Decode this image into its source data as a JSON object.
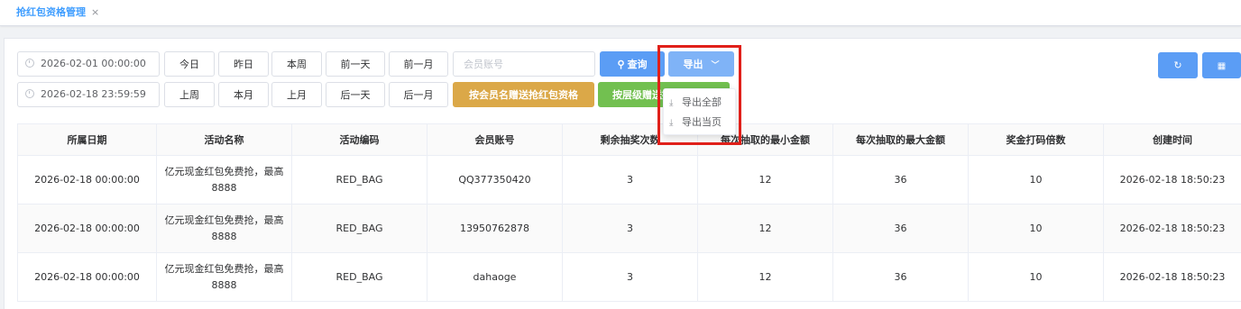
{
  "tab": {
    "label": "抢红包资格管理",
    "close": "×"
  },
  "filters": {
    "start_date": "2026-02-01 00:00:00",
    "end_date": "2026-02-18 23:59:59",
    "member_placeholder": "会员账号",
    "row1_buttons": [
      "今日",
      "昨日",
      "本周",
      "前一天",
      "前一月"
    ],
    "row2_buttons": [
      "上周",
      "本月",
      "上月",
      "后一天",
      "后一月"
    ],
    "query_label": "查询",
    "export_label": "导出",
    "gift_by_member_label": "按会员名赠送抢红包资格",
    "gift_by_level_label": "按层级赠送抢红包资格"
  },
  "export_menu": {
    "items": [
      {
        "label": "导出全部",
        "icon": "download-icon"
      },
      {
        "label": "导出当页",
        "icon": "download-icon"
      }
    ]
  },
  "toolbar": {
    "refresh_icon": "refresh-icon",
    "grid_icon": "grid-icon"
  },
  "colors": {
    "primary": "#5b9df5",
    "warning": "#dba848",
    "success": "#72c050",
    "highlight": "#e0201a"
  },
  "table": {
    "headers": [
      "所属日期",
      "活动名称",
      "活动编码",
      "会员账号",
      "剩余抽奖次数",
      "每次抽取的最小金额",
      "每次抽取的最大金额",
      "奖金打码倍数",
      "创建时间"
    ],
    "rows": [
      [
        "2026-02-18 00:00:00",
        "亿元现金红包免费抢，最高8888",
        "RED_BAG",
        "QQ377350420",
        "3",
        "12",
        "36",
        "10",
        "2026-02-18 18:50:23"
      ],
      [
        "2026-02-18 00:00:00",
        "亿元现金红包免费抢，最高8888",
        "RED_BAG",
        "13950762878",
        "3",
        "12",
        "36",
        "10",
        "2026-02-18 18:50:23"
      ],
      [
        "2026-02-18 00:00:00",
        "亿元现金红包免费抢，最高8888",
        "RED_BAG",
        "dahaoge",
        "3",
        "12",
        "36",
        "10",
        "2026-02-18 18:50:23"
      ]
    ]
  }
}
